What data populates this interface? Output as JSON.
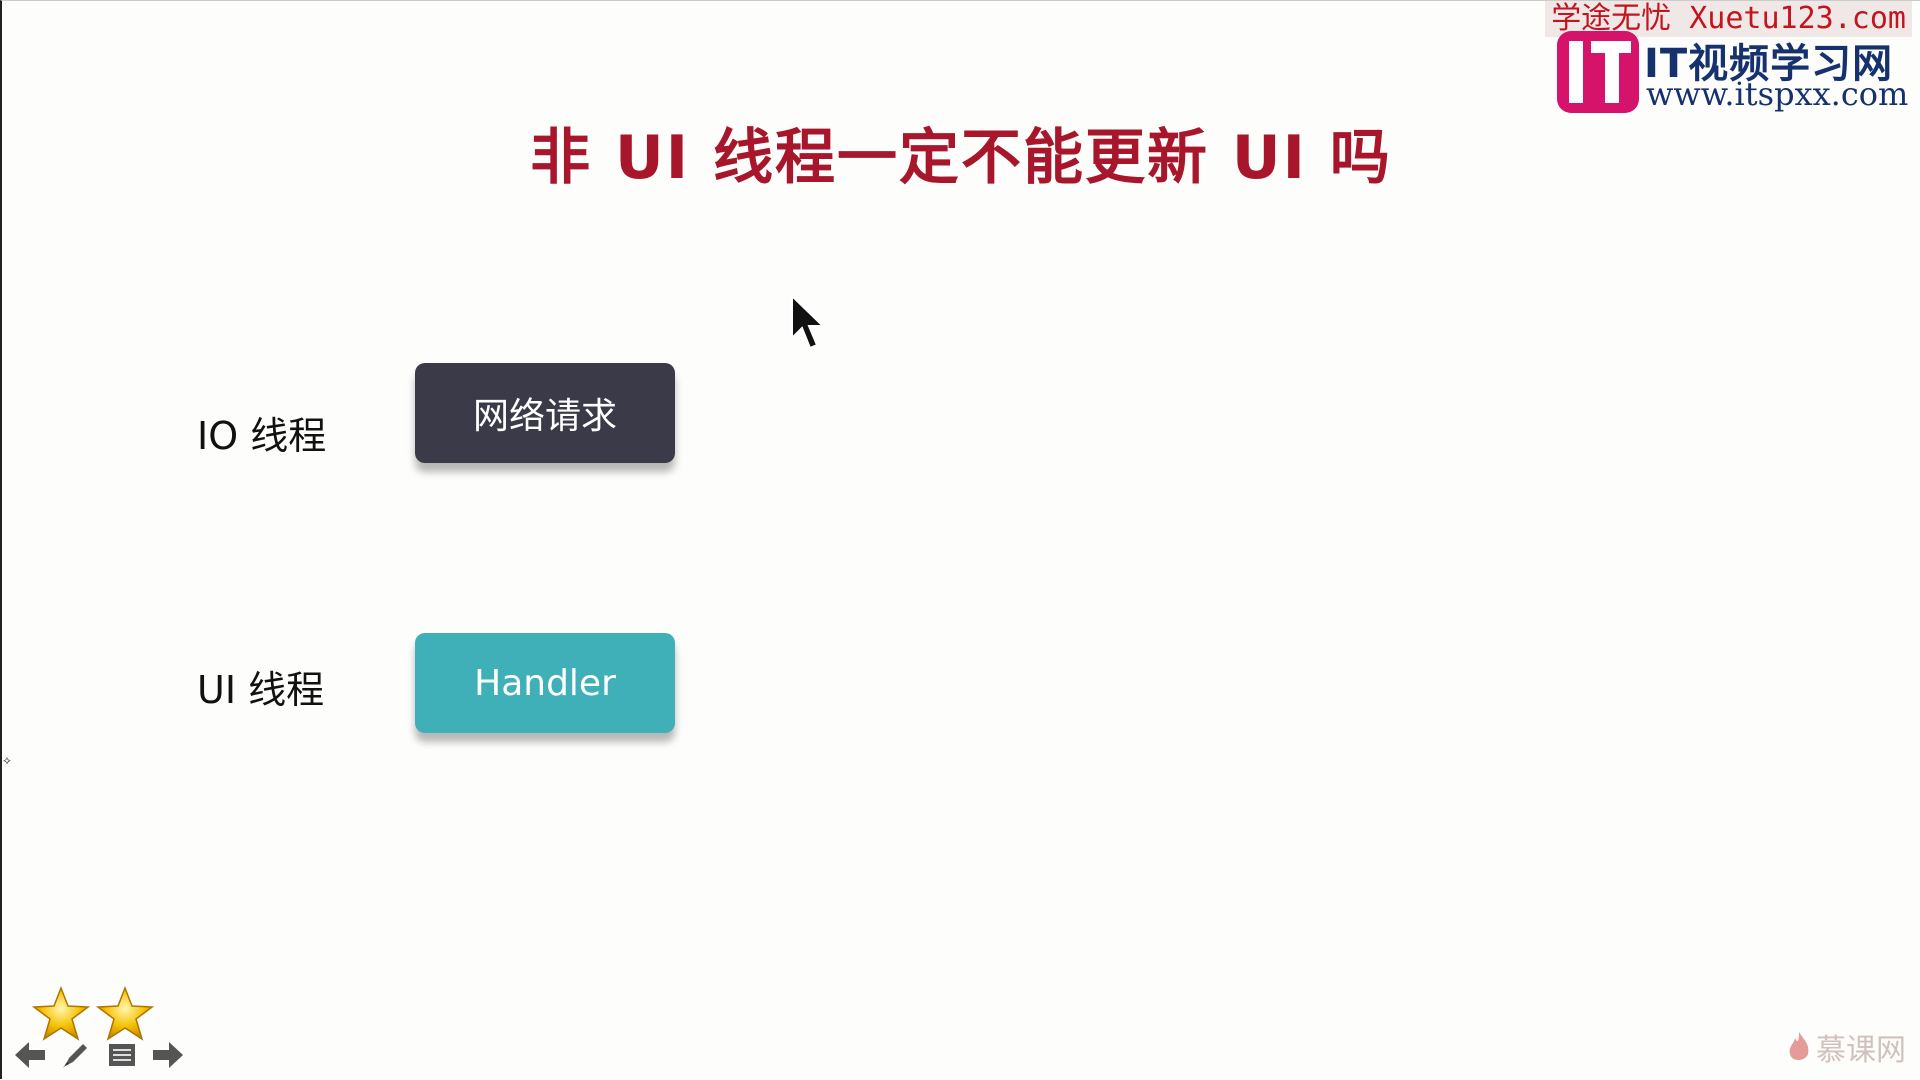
{
  "slide": {
    "title": "非 UI 线程一定不能更新 UI 吗",
    "rows": [
      {
        "label": "IO 线程",
        "box": "网络请求"
      },
      {
        "label": "UI 线程",
        "box": "Handler"
      }
    ]
  },
  "watermark": {
    "top_text": "学途无忧 Xuetu123.com",
    "site_name": "IT视频学习网",
    "site_url": "www.itspxx.com"
  },
  "footer": {
    "brand": "慕课网"
  },
  "controls": [
    "prev-icon",
    "pen-icon",
    "menu-icon",
    "next-icon"
  ],
  "colors": {
    "title": "#a8162c",
    "io_box": "#3b3a48",
    "ui_box": "#3fb0b8",
    "watermark_text": "#c4141e",
    "logo": "#d5136a"
  }
}
